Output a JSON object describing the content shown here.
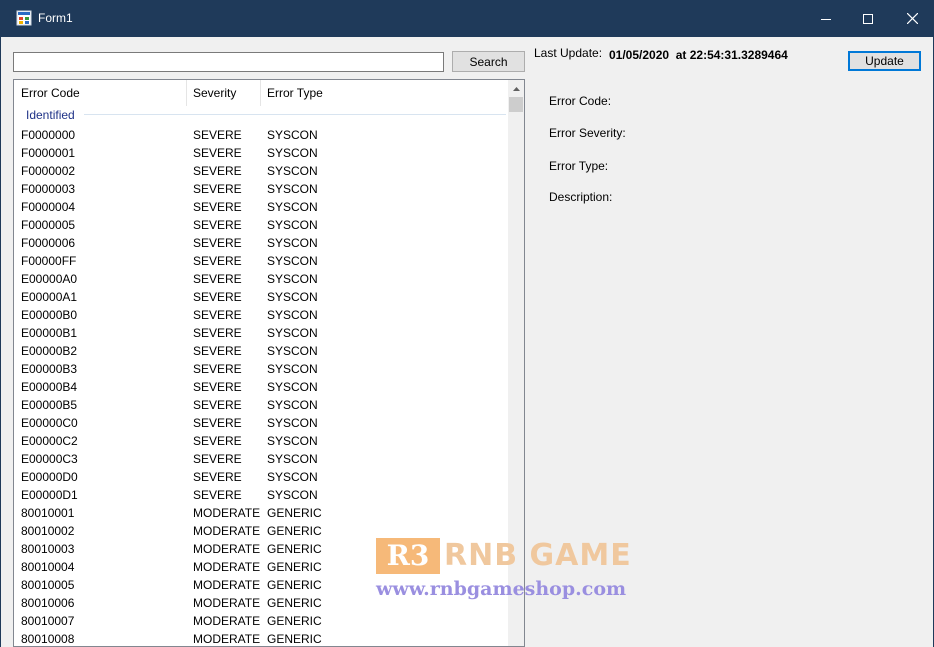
{
  "window": {
    "title": "Form1",
    "frame_color": "#1f3a5a",
    "icon": "form-app-icon",
    "controls": [
      "minimize-icon",
      "maximize-icon",
      "close-icon"
    ]
  },
  "toolbar": {
    "search_value": "",
    "search_label": "Search",
    "last_update_label": "Last Update:",
    "last_update_value": "01/05/2020  at 22:54:31.3289464",
    "update_label": "Update"
  },
  "list": {
    "columns": [
      "Error Code",
      "Severity",
      "Error Type"
    ],
    "group": "Identified",
    "rows": [
      [
        "F0000000",
        "SEVERE",
        "SYSCON"
      ],
      [
        "F0000001",
        "SEVERE",
        "SYSCON"
      ],
      [
        "F0000002",
        "SEVERE",
        "SYSCON"
      ],
      [
        "F0000003",
        "SEVERE",
        "SYSCON"
      ],
      [
        "F0000004",
        "SEVERE",
        "SYSCON"
      ],
      [
        "F0000005",
        "SEVERE",
        "SYSCON"
      ],
      [
        "F0000006",
        "SEVERE",
        "SYSCON"
      ],
      [
        "F00000FF",
        "SEVERE",
        "SYSCON"
      ],
      [
        "E00000A0",
        "SEVERE",
        "SYSCON"
      ],
      [
        "E00000A1",
        "SEVERE",
        "SYSCON"
      ],
      [
        "E00000B0",
        "SEVERE",
        "SYSCON"
      ],
      [
        "E00000B1",
        "SEVERE",
        "SYSCON"
      ],
      [
        "E00000B2",
        "SEVERE",
        "SYSCON"
      ],
      [
        "E00000B3",
        "SEVERE",
        "SYSCON"
      ],
      [
        "E00000B4",
        "SEVERE",
        "SYSCON"
      ],
      [
        "E00000B5",
        "SEVERE",
        "SYSCON"
      ],
      [
        "E00000C0",
        "SEVERE",
        "SYSCON"
      ],
      [
        "E00000C2",
        "SEVERE",
        "SYSCON"
      ],
      [
        "E00000C3",
        "SEVERE",
        "SYSCON"
      ],
      [
        "E00000D0",
        "SEVERE",
        "SYSCON"
      ],
      [
        "E00000D1",
        "SEVERE",
        "SYSCON"
      ],
      [
        "80010001",
        "MODERATE",
        "GENERIC"
      ],
      [
        "80010002",
        "MODERATE",
        "GENERIC"
      ],
      [
        "80010003",
        "MODERATE",
        "GENERIC"
      ],
      [
        "80010004",
        "MODERATE",
        "GENERIC"
      ],
      [
        "80010005",
        "MODERATE",
        "GENERIC"
      ],
      [
        "80010006",
        "MODERATE",
        "GENERIC"
      ],
      [
        "80010007",
        "MODERATE",
        "GENERIC"
      ],
      [
        "80010008",
        "MODERATE",
        "GENERIC"
      ]
    ]
  },
  "details": {
    "code_label": "Error Code:",
    "severity_label": "Error Severity:",
    "type_label": "Error Type:",
    "description_label": "Description:"
  },
  "watermark": {
    "logo": "R3",
    "brand": "RNB GAME",
    "url": "www.rnbgameshop.com"
  }
}
